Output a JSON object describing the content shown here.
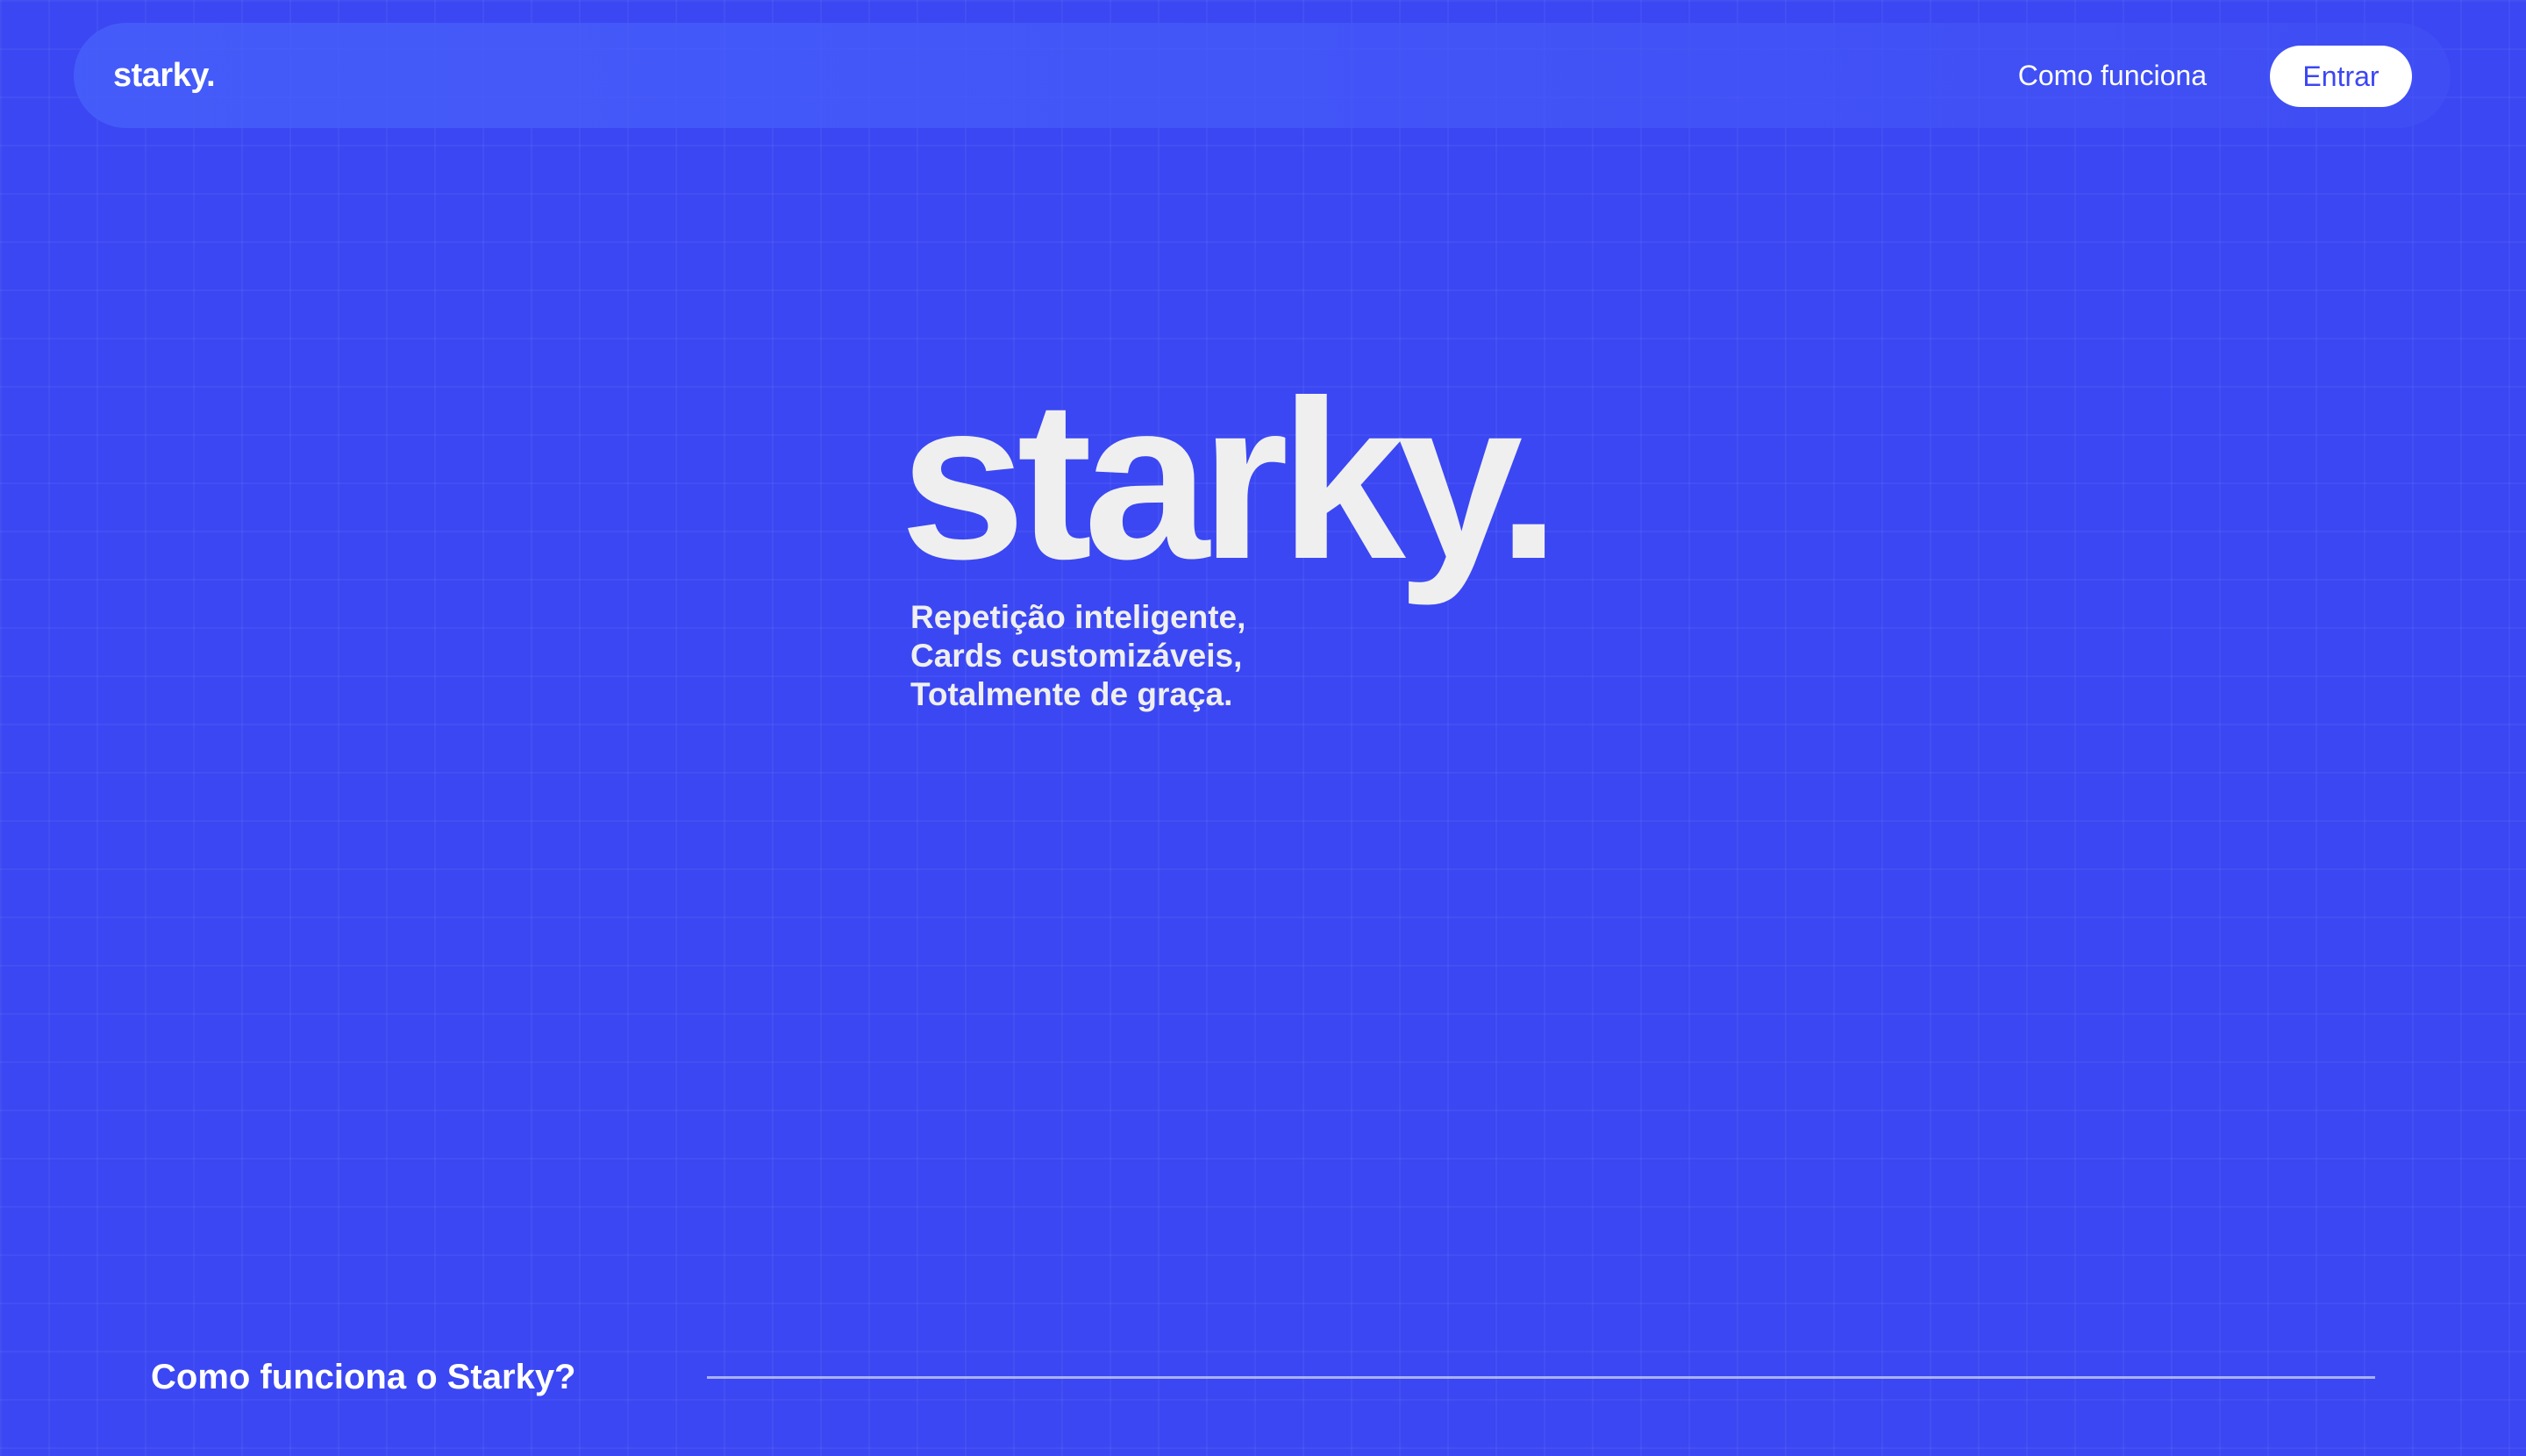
{
  "colors": {
    "background": "#3b47f2",
    "accent_text": "#3b47f2",
    "foreground": "#ffffff"
  },
  "navbar": {
    "logo": "starky.",
    "link_how_it_works": "Como funciona",
    "login_button": "Entrar"
  },
  "hero": {
    "title": "starky.",
    "tagline": [
      "Repetição inteligente,",
      "Cards customizáveis,",
      "Totalmente de graça."
    ]
  },
  "section": {
    "heading": "Como funciona o Starky?"
  }
}
